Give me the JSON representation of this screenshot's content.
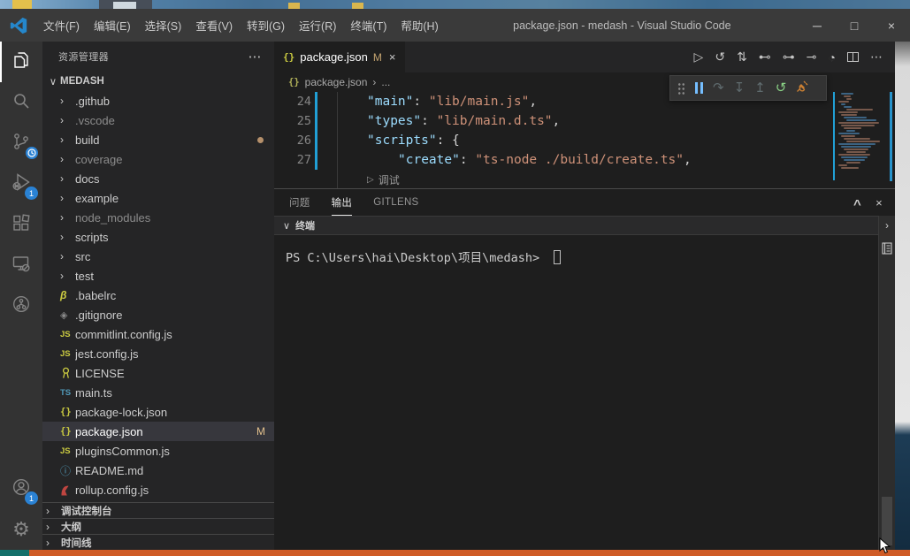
{
  "window": {
    "title": "package.json - medash - Visual Studio Code",
    "controls": [
      {
        "name": "minimize-button",
        "glyph": "─"
      },
      {
        "name": "maximize-button",
        "glyph": "□"
      },
      {
        "name": "close-button",
        "glyph": "×"
      }
    ]
  },
  "menus": [
    {
      "label": "文件(F)"
    },
    {
      "label": "编辑(E)"
    },
    {
      "label": "选择(S)"
    },
    {
      "label": "查看(V)"
    },
    {
      "label": "转到(G)"
    },
    {
      "label": "运行(R)"
    },
    {
      "label": "终端(T)"
    },
    {
      "label": "帮助(H)"
    }
  ],
  "activity_bar": {
    "top": [
      {
        "name": "explorer",
        "active": true
      },
      {
        "name": "search"
      },
      {
        "name": "source-control",
        "badge": "clock"
      },
      {
        "name": "run-debug",
        "badge": "1"
      },
      {
        "name": "extensions"
      },
      {
        "name": "remote-explorer"
      },
      {
        "name": "gitlens"
      }
    ],
    "bottom": [
      {
        "name": "account",
        "badge": "1"
      },
      {
        "name": "settings"
      }
    ]
  },
  "sidebar": {
    "header": "资源管理器",
    "more": "⋯",
    "root": "MEDASH",
    "root_chevron": "∨",
    "files": [
      {
        "name": ".github",
        "kind": "folder"
      },
      {
        "name": ".vscode",
        "kind": "folder",
        "dimmed": true
      },
      {
        "name": "build",
        "kind": "folder",
        "dot": true
      },
      {
        "name": "coverage",
        "kind": "folder",
        "dimmed": true
      },
      {
        "name": "docs",
        "kind": "folder"
      },
      {
        "name": "example",
        "kind": "folder"
      },
      {
        "name": "node_modules",
        "kind": "folder",
        "dimmed": true
      },
      {
        "name": "scripts",
        "kind": "folder"
      },
      {
        "name": "src",
        "kind": "folder"
      },
      {
        "name": "test",
        "kind": "folder"
      },
      {
        "name": ".babelrc",
        "kind": "babel"
      },
      {
        "name": ".gitignore",
        "kind": "git"
      },
      {
        "name": "commitlint.config.js",
        "kind": "js"
      },
      {
        "name": "jest.config.js",
        "kind": "js"
      },
      {
        "name": "LICENSE",
        "kind": "license"
      },
      {
        "name": "main.ts",
        "kind": "ts"
      },
      {
        "name": "package-lock.json",
        "kind": "json"
      },
      {
        "name": "package.json",
        "kind": "json",
        "selected": true,
        "badge": "M"
      },
      {
        "name": "pluginsCommon.js",
        "kind": "js"
      },
      {
        "name": "README.md",
        "kind": "readme"
      },
      {
        "name": "rollup.config.js",
        "kind": "rollup"
      }
    ],
    "sections": [
      {
        "label": "调试控制台"
      },
      {
        "label": "大纲"
      },
      {
        "label": "时间线"
      }
    ]
  },
  "editor": {
    "tab": {
      "icon": "{}",
      "label": "package.json",
      "modified": "M",
      "close": "×"
    },
    "breadcrumb": {
      "icon": "{}",
      "file": "package.json",
      "sep": "›",
      "more": "..."
    },
    "actions": [
      {
        "name": "run-button",
        "glyph": "▷"
      },
      {
        "name": "history-button",
        "glyph": "↺"
      },
      {
        "name": "git-compare-button",
        "glyph": "⇅"
      },
      {
        "name": "open-previous-change-button",
        "glyph": "⊷"
      },
      {
        "name": "open-change-button",
        "glyph": "⊶"
      },
      {
        "name": "open-next-change-button",
        "glyph": "⊸"
      },
      {
        "name": "gitlens-button",
        "glyph": "◔"
      },
      {
        "name": "split-editor-button",
        "glyph": ""
      },
      {
        "name": "more-actions-button",
        "glyph": "⋯"
      }
    ],
    "code_lines": [
      {
        "num": "24",
        "indent": 1,
        "tokens": [
          [
            "key",
            "\"main\""
          ],
          [
            "p",
            ": "
          ],
          [
            "str",
            "\"lib/main.js\""
          ],
          [
            "p",
            ","
          ]
        ]
      },
      {
        "num": "25",
        "indent": 1,
        "tokens": [
          [
            "key",
            "\"types\""
          ],
          [
            "p",
            ": "
          ],
          [
            "str",
            "\"lib/main.d.ts\""
          ],
          [
            "p",
            ","
          ]
        ]
      },
      {
        "lens": true,
        "glyph": "▷",
        "label": "调试"
      },
      {
        "num": "26",
        "indent": 1,
        "tokens": [
          [
            "key",
            "\"scripts\""
          ],
          [
            "p",
            ": {"
          ]
        ]
      },
      {
        "num": "27",
        "indent": 2,
        "tokens": [
          [
            "key",
            "\"create\""
          ],
          [
            "p",
            ": "
          ],
          [
            "str",
            "\"ts-node ./build/create.ts\""
          ],
          [
            "p",
            ","
          ]
        ]
      }
    ]
  },
  "debug_toolbar": [
    {
      "name": "drag-handle",
      "kind": "grip"
    },
    {
      "name": "pause-button",
      "kind": "pause"
    },
    {
      "name": "step-over-button",
      "glyph": "↷",
      "color": "#5f6b6e"
    },
    {
      "name": "step-into-button",
      "glyph": "↧",
      "color": "#5f6b6e"
    },
    {
      "name": "step-out-button",
      "glyph": "↥",
      "color": "#5f6b6e"
    },
    {
      "name": "restart-button",
      "glyph": "↺",
      "color": "#89d185"
    },
    {
      "name": "disconnect-button",
      "kind": "plug",
      "color": "#cc8033"
    }
  ],
  "panel": {
    "tabs": [
      {
        "label": "问题"
      },
      {
        "label": "输出",
        "active": true
      },
      {
        "label": "GITLENS"
      }
    ],
    "actions": [
      {
        "name": "maximize-panel-button",
        "glyph": "^"
      },
      {
        "name": "close-panel-button",
        "glyph": "×"
      }
    ],
    "terminal": {
      "chevron": "∨",
      "section": "终端",
      "prompt": "PS C:\\Users\\hai\\Desktop\\项目\\medash>",
      "rail_chevron": "›"
    }
  },
  "colors": {
    "badge_blue": "#2a82d4",
    "modified_gold": "#e2c08d",
    "gutter_modified_blue": "#219fd5",
    "key_blue": "#9cdcfe",
    "string_orange": "#ce9178",
    "taskbar_orange": "#cf5b26",
    "taskbar_teal": "#14706a"
  }
}
